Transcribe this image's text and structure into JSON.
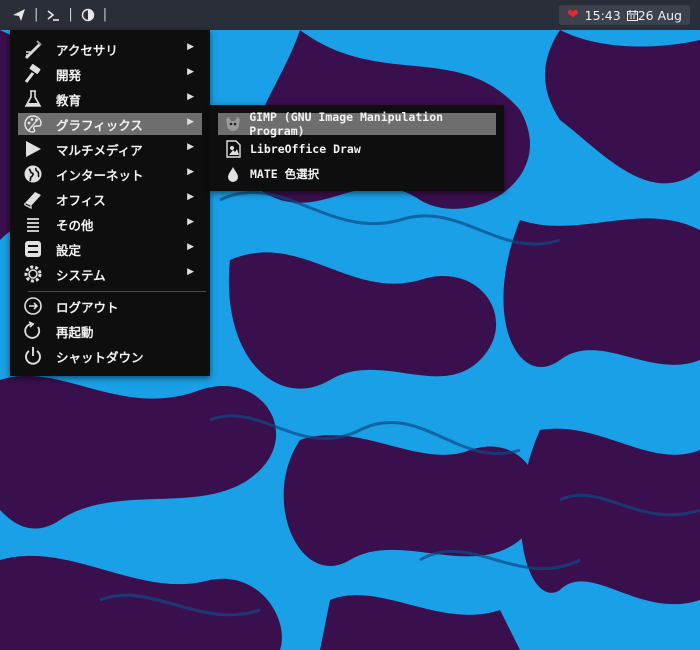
{
  "panel": {
    "clock": "15:43",
    "date": "26 Aug",
    "separator": "|"
  },
  "main_menu": {
    "items": [
      {
        "label": "アクセサリ",
        "icon": "accessories-icon",
        "has_submenu": true
      },
      {
        "label": "開発",
        "icon": "hammer-icon",
        "has_submenu": true
      },
      {
        "label": "教育",
        "icon": "flask-icon",
        "has_submenu": true
      },
      {
        "label": "グラフィックス",
        "icon": "palette-icon",
        "has_submenu": true,
        "active": true
      },
      {
        "label": "マルチメディア",
        "icon": "play-icon",
        "has_submenu": true
      },
      {
        "label": "インターネット",
        "icon": "globe-icon",
        "has_submenu": true
      },
      {
        "label": "オフィス",
        "icon": "book-icon",
        "has_submenu": true
      },
      {
        "label": "その他",
        "icon": "list-icon",
        "has_submenu": true
      },
      {
        "label": "設定",
        "icon": "toggles-icon",
        "has_submenu": true
      },
      {
        "label": "システム",
        "icon": "gear-icon",
        "has_submenu": true
      }
    ],
    "session_items": [
      {
        "label": "ログアウト",
        "icon": "logout-icon"
      },
      {
        "label": "再起動",
        "icon": "restart-icon"
      },
      {
        "label": "シャットダウン",
        "icon": "power-icon"
      }
    ],
    "arrow": "▶"
  },
  "graphics_submenu": {
    "items": [
      {
        "label": "GIMP (GNU Image Manipulation Program)",
        "icon": "gimp-icon",
        "active": true
      },
      {
        "label": "LibreOffice Draw",
        "icon": "draw-icon"
      },
      {
        "label": "MATE 色選択",
        "icon": "color-drop-icon"
      }
    ]
  },
  "colors": {
    "panel_bg": "#2a2e38",
    "menu_bg": "#0e0e0f",
    "highlight": "#6e6e6e",
    "wallpaper_blue": "#1aa0e6",
    "wallpaper_purple": "#3a0f4d"
  }
}
